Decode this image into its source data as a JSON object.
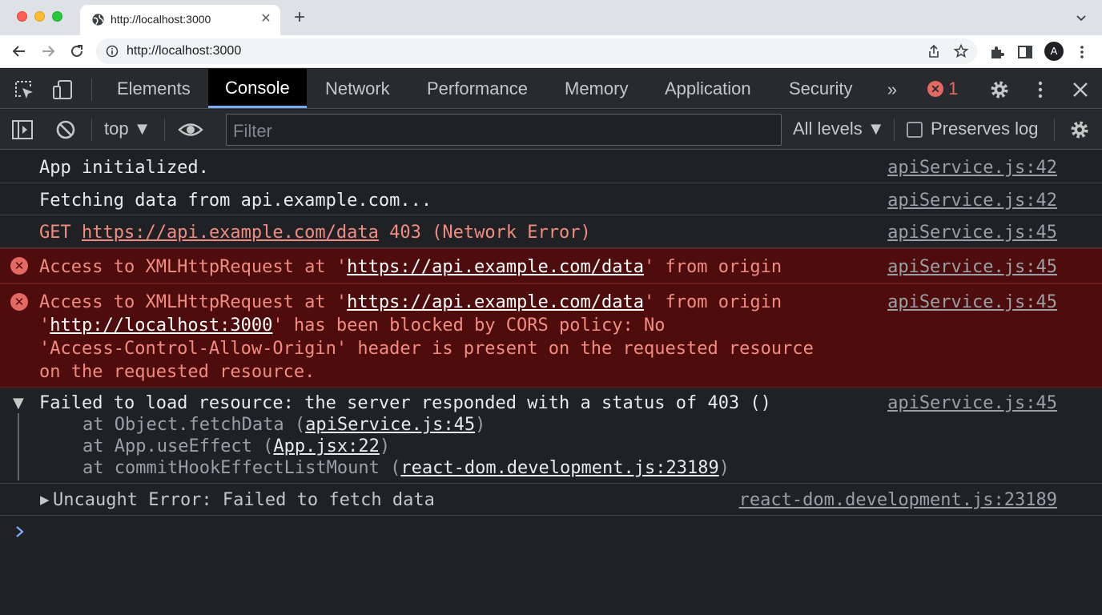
{
  "browser": {
    "tab_title": "http://localhost:3000",
    "tab_close": "✕",
    "new_tab": "+",
    "url": "http://localhost:3000",
    "profile_initial": "A"
  },
  "devtools": {
    "tabs": [
      "Elements",
      "Console",
      "Network",
      "Performance",
      "Memory",
      "Application",
      "Security"
    ],
    "active_tab": "Console",
    "more_tabs": "»",
    "error_badge_icon": "✕",
    "error_count": "1"
  },
  "console_toolbar": {
    "context": "top ▼",
    "filter_placeholder": "Filter",
    "levels": "All levels ▼",
    "preserve_log": "Preserves log"
  },
  "messages": {
    "m1": {
      "text": "App initialized.",
      "source": "apiService.js:42"
    },
    "m2": {
      "text": "Fetching data from api.example.com...",
      "source": "apiService.js:42"
    },
    "m3": {
      "method": "GET",
      "url": "https://api.example.com/data",
      "status": "403 (Network Error)",
      "source": "apiService.js:45"
    },
    "m4": {
      "prefix": "Access to XMLHttpRequest at '",
      "url": "https://api.example.com/data",
      "suffix": "' from origin",
      "source": "apiService.js:45"
    },
    "m5": {
      "prefix": "Access to XMLHttpRequest at '",
      "url": "https://api.example.com/data",
      "suffix": "' from origin",
      "line2_open": "'",
      "origin": "http://localhost:3000",
      "line2_rest": "' has been blocked by CORS policy: No",
      "line3": "'Access-Control-Allow-Origin' header is present on the requested resource",
      "line4": "on the requested resource.",
      "source": "apiService.js:45"
    },
    "m6": {
      "text": "Failed to load resource: the server responded with a status of 403 ()",
      "source": "apiService.js:45",
      "stack": [
        {
          "prefix": "at Object.fetchData (",
          "link": "apiService.js:45",
          "suffix": ")"
        },
        {
          "prefix": "at App.useEffect (",
          "link": "App.jsx:22",
          "suffix": ")"
        },
        {
          "prefix": "at commitHookEffectListMount (",
          "link": "react-dom.development.js:23189",
          "suffix": ")"
        }
      ]
    },
    "m7": {
      "text": "Uncaught Error: Failed to fetch data",
      "source": "react-dom.development.js:23189"
    }
  },
  "icons": {
    "error": "error-circle-icon",
    "inspect": "inspect-element-icon",
    "device": "device-toolbar-icon",
    "settings": "gear-icon"
  },
  "colors": {
    "error_text": "#f28b82",
    "error_bg": "#4e0c0c",
    "active_tab_underline": "#7cacf8"
  }
}
